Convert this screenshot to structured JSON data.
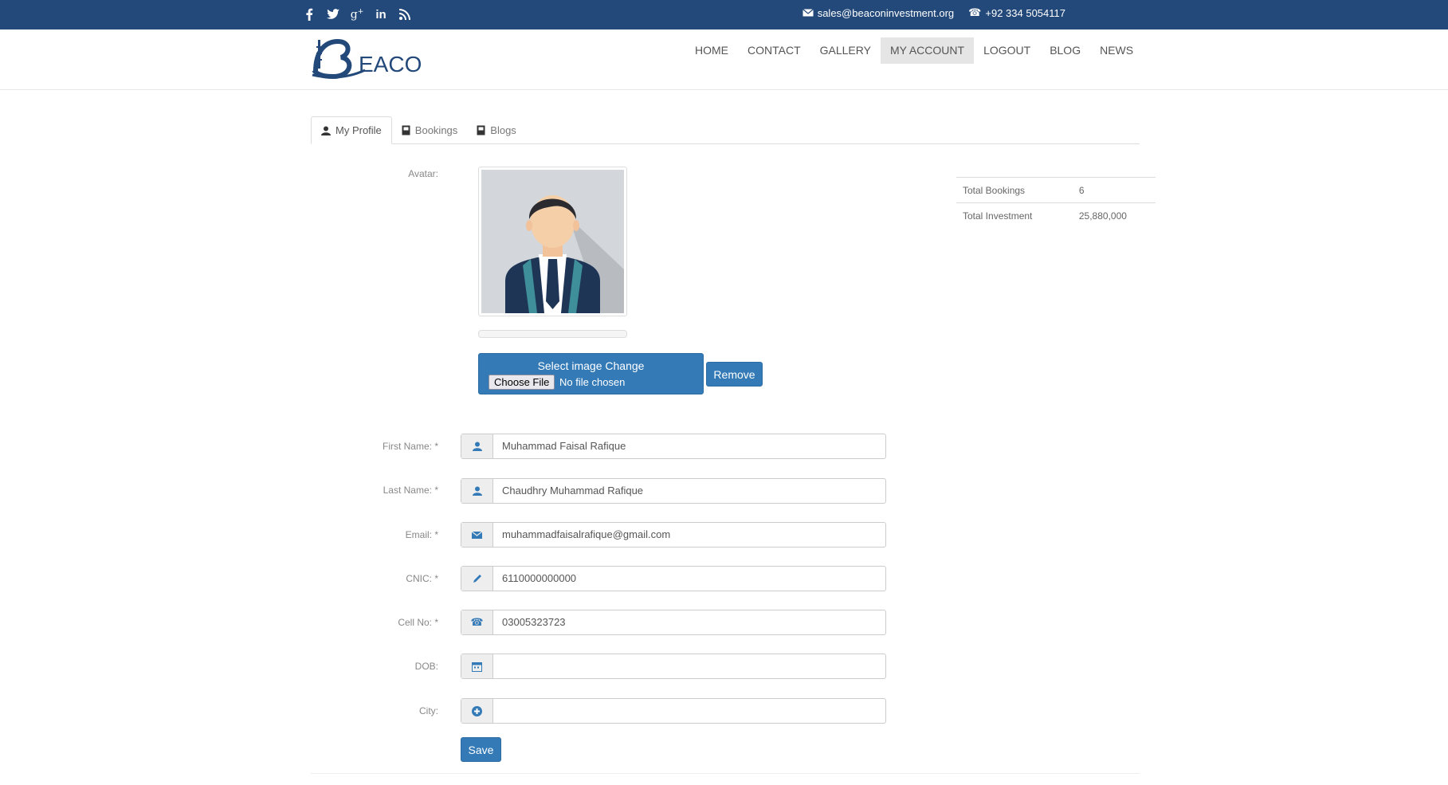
{
  "topbar": {
    "social": [
      {
        "icon": "facebook-icon",
        "glyph": "f"
      },
      {
        "icon": "twitter-icon",
        "glyph": "🐦"
      },
      {
        "icon": "google-plus-icon",
        "glyph": "g+"
      },
      {
        "icon": "linkedin-icon",
        "glyph": "in"
      },
      {
        "icon": "rss-icon",
        "glyph": "))"
      }
    ],
    "email": "sales@beaconinvestment.org",
    "phone": "+92 334 5054117"
  },
  "header": {
    "logo_text": "EACON",
    "nav": {
      "home": "HOME",
      "contact": "CONTACT",
      "gallery": "GALLERY",
      "my_account": "MY ACCOUNT",
      "logout": "LOGOUT",
      "blog": "BLOG",
      "news": "NEWS"
    }
  },
  "tabs": {
    "profile": "My Profile",
    "bookings": "Bookings",
    "blogs": "Blogs"
  },
  "profile": {
    "avatar_label": "Avatar:",
    "select_image": "Select image Change",
    "choose_file": "Choose File",
    "no_file": "No file chosen",
    "remove": "Remove",
    "first_name_label": "First Name: *",
    "first_name": "Muhammad Faisal Rafique",
    "last_name_label": "Last Name: *",
    "last_name": "Chaudhry Muhammad Rafique",
    "email_label": "Email: *",
    "email": "muhammadfaisalrafique@gmail.com",
    "cnic_label": "CNIC: *",
    "cnic": "6110000000000",
    "cell_label": "Cell No: *",
    "cell": "03005323723",
    "dob_label": "DOB:",
    "dob": "",
    "city_label": "City:",
    "city": "",
    "save": "Save"
  },
  "stats": {
    "bookings_label": "Total Bookings",
    "bookings_value": "6",
    "investment_label": "Total Investment",
    "investment_value": "25,880,000"
  },
  "colors": {
    "topbar": "#23497a",
    "primary": "#337ab7"
  }
}
